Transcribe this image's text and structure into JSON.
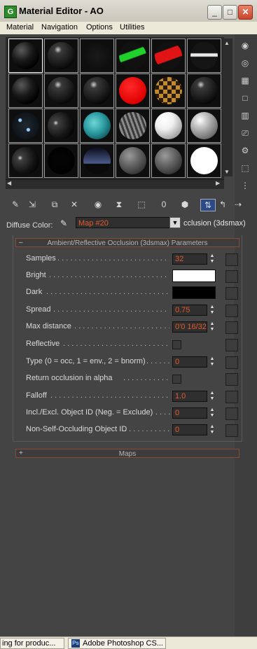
{
  "window": {
    "title": "Material Editor - AO",
    "app_icon": "G",
    "controls": {
      "minimize": "_",
      "maximize": "□",
      "close": "✕"
    }
  },
  "menu": [
    "Material",
    "Navigation",
    "Options",
    "Utilities"
  ],
  "slots": [
    "black-glossy",
    "dark-glossy",
    "white-blob",
    "green-pattern",
    "red-pattern",
    "white-arrow",
    "black-glossy",
    "dark-glossy",
    "dark-glossy",
    "red-solid",
    "checker",
    "dark-glossy",
    "dark-specks",
    "dark-highlight",
    "teal-noise",
    "gray-swirl",
    "white-matte",
    "gray-matte",
    "dark-highlight",
    "black-solid",
    "dark-scene",
    "mid-gray",
    "mid-gray",
    "white-flat"
  ],
  "side_icons": [
    "sample-type-icon",
    "backlight-icon",
    "background-icon",
    "uv-tiling-icon",
    "video-check-icon",
    "make-preview-icon",
    "options-icon",
    "select-by-material-icon",
    "material-navigator-icon"
  ],
  "toolbar_icons": [
    "get-material-icon",
    "put-to-scene-icon",
    "assign-to-selection-icon",
    "reset-icon",
    "make-copy-icon",
    "make-unique-icon",
    "put-to-library-icon",
    "material-id-icon",
    "show-map-icon",
    "show-end-result-icon",
    "go-to-parent-icon",
    "go-forward-icon"
  ],
  "toolbar_icon_glyphs": [
    "✎",
    "⇲",
    "⧉",
    "✕",
    "◉",
    "⧗",
    "⬚",
    "0",
    "⬢",
    "⇅",
    "↰",
    "⇢"
  ],
  "diffuse": {
    "label": "Diffuse Color:",
    "map_name": "Map #20",
    "map_type": "cclusion (3dsmax)"
  },
  "rollout": {
    "sign": "–",
    "title": "Ambient/Reflective Occlusion (3dsmax) Parameters"
  },
  "params": {
    "samples": {
      "label": "Samples",
      "value": "32"
    },
    "bright": {
      "label": "Bright",
      "color": "#ffffff"
    },
    "dark": {
      "label": "Dark",
      "color": "#000000"
    },
    "spread": {
      "label": "Spread",
      "value": "0.75"
    },
    "max_distance": {
      "label": "Max distance",
      "value": "0'0 16/32\""
    },
    "reflective": {
      "label": "Reflective"
    },
    "type": {
      "label": "Type (0 = occ, 1 = env., 2 = bnorm)",
      "value": "0"
    },
    "return_occlusion": {
      "label": "Return occlusion in alpha"
    },
    "falloff": {
      "label": "Falloff",
      "value": "1.0"
    },
    "incl_excl": {
      "label": "Incl./Excl. Object ID (Neg. = Exclude)",
      "value": "0"
    },
    "non_self": {
      "label": "Non-Self-Occluding Object ID",
      "value": "0"
    }
  },
  "maps_rollout": {
    "sign": "+",
    "title": "Maps"
  },
  "taskbar": [
    {
      "label": "ing for produc..."
    },
    {
      "label": "Adobe Photoshop CS...",
      "icon": "Ps"
    }
  ],
  "accent_color": "#e45a2c"
}
